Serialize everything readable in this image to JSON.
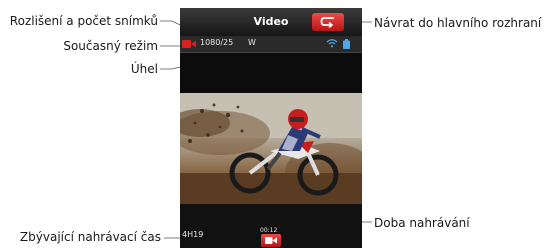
{
  "callouts": {
    "resolution": "Rozlišení a počet snímků",
    "mode": "Současný režim",
    "angle": "Úhel",
    "remaining_time": "Zbývající nahrávací čas",
    "return_home": "Návrat do hlavního rozhraní",
    "recording_duration": "Doba nahrávání"
  },
  "screen": {
    "title": "Video",
    "resolution_fps": "1080/25",
    "angle": "W",
    "remaining": "4H19",
    "rec_time": "00:12"
  },
  "colors": {
    "accent_red": "#d92020",
    "wifi": "#4aa8e8",
    "battery": "#4aa8e8"
  },
  "icons": {
    "return": "return-arrow-icon",
    "mode": "video-camera-icon",
    "wifi": "wifi-icon",
    "battery": "battery-icon",
    "record": "video-camera-icon"
  }
}
